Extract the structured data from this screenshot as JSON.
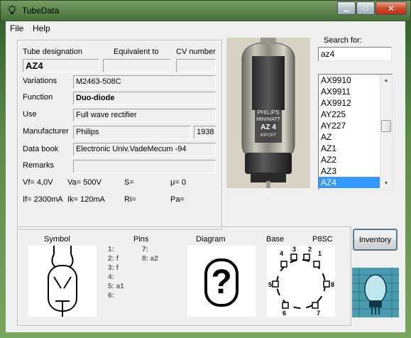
{
  "window": {
    "title": "TubeData",
    "controls": {
      "minimize": "▁",
      "maximize": "□",
      "close": "✕"
    }
  },
  "menu": {
    "file": "File",
    "help": "Help"
  },
  "search": {
    "label": "Search for:",
    "value": "az4"
  },
  "tube_list": {
    "items": [
      "AX9910",
      "AX9911",
      "AX9912",
      "AY225",
      "AY227",
      "AZ",
      "AZ1",
      "AZ2",
      "AZ3",
      "AZ4"
    ],
    "selected": "AZ4"
  },
  "info": {
    "designation_label": "Tube designation",
    "designation": "AZ4",
    "equivalent_label": "Equivalent to",
    "equivalent": "",
    "cv_label": "CV number",
    "cv": "",
    "variations_label": "Variations",
    "variations": "M2463-508C",
    "function_label": "Function",
    "function": "Duo-diode",
    "use_label": "Use",
    "use": "Full wave rectifier",
    "manufacturer_label": "Manufacturer",
    "manufacturer": "Philips",
    "year": "1938",
    "databook_label": "Data book",
    "databook": "Electronic Univ.VadeMecum -94",
    "remarks_label": "Remarks",
    "remarks": ""
  },
  "params": {
    "vf": "Vf= 4,0V",
    "va": "Va=  500V",
    "s": "S=",
    "mu": "μ=    0",
    "if": "If= 2300mA",
    "ik": "Ik=   120mA",
    "ri": "Ri=",
    "pa": "Pa="
  },
  "tube_photo": {
    "brand": "PHILIPS",
    "brand2": "MINIWATT",
    "type": "AZ 4",
    "extra": "IMPORT"
  },
  "lower": {
    "symbol_label": "Symbol",
    "pins_label": "Pins",
    "diagram_label": "Diagram",
    "base_label": "Base",
    "base_type": "P8SC",
    "diagram_glyph": "?",
    "pins_left": [
      "1:",
      "2: f",
      "3: f",
      "4:",
      "5: a1",
      "6:"
    ],
    "pins_right": [
      "7:",
      "8: a2"
    ],
    "base_pin_numbers": [
      "1",
      "2",
      "3",
      "4",
      "5",
      "6",
      "7",
      "8"
    ]
  },
  "inventory_button": "Inventory",
  "colors": {
    "selection": "#3399ff",
    "logo_bg": "#4a9bb0"
  }
}
